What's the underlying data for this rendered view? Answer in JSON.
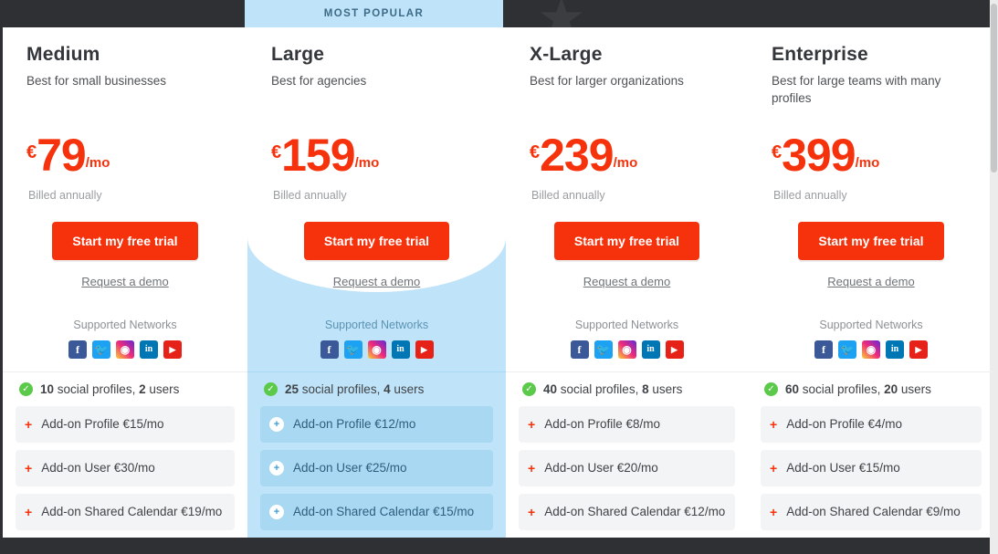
{
  "banner": {
    "most_popular": "MOST POPULAR"
  },
  "labels": {
    "billed": "Billed annually",
    "cta": "Start my free trial",
    "demo": "Request a demo",
    "networks": "Supported Networks",
    "currency": "€",
    "per": "/mo"
  },
  "networks": [
    {
      "name": "facebook-icon",
      "glyph": "f"
    },
    {
      "name": "twitter-icon",
      "glyph": "🐦"
    },
    {
      "name": "instagram-icon",
      "glyph": "◉"
    },
    {
      "name": "linkedin-icon",
      "glyph": "in"
    },
    {
      "name": "youtube-icon",
      "glyph": "▶"
    }
  ],
  "colors": {
    "accent": "#f5320c",
    "featured_bg": "#bfe3f8",
    "banner_bg": "#bfe3f8",
    "page_bg": "#2f3033",
    "check_green": "#5bc94a"
  },
  "plans": [
    {
      "name": "Medium",
      "desc": "Best for small businesses",
      "price": "79",
      "featured": false,
      "profiles_count": "10",
      "profiles_label": " social profiles, ",
      "users_count": "2",
      "users_label": " users",
      "addons": [
        "Add-on Profile €15/mo",
        "Add-on User €30/mo",
        "Add-on Shared Calendar €19/mo"
      ]
    },
    {
      "name": "Large",
      "desc": "Best for agencies",
      "price": "159",
      "featured": true,
      "profiles_count": "25",
      "profiles_label": " social profiles, ",
      "users_count": "4",
      "users_label": " users",
      "addons": [
        "Add-on Profile €12/mo",
        "Add-on User €25/mo",
        "Add-on Shared Calendar €15/mo"
      ]
    },
    {
      "name": "X-Large",
      "desc": "Best for larger organizations",
      "price": "239",
      "featured": false,
      "profiles_count": "40",
      "profiles_label": " social profiles, ",
      "users_count": "8",
      "users_label": " users",
      "addons": [
        "Add-on Profile €8/mo",
        "Add-on User €20/mo",
        "Add-on Shared Calendar €12/mo"
      ]
    },
    {
      "name": "Enterprise",
      "desc": "Best for large teams with many profiles",
      "price": "399",
      "featured": false,
      "profiles_count": "60",
      "profiles_label": " social profiles, ",
      "users_count": "20",
      "users_label": " users",
      "addons": [
        "Add-on Profile €4/mo",
        "Add-on User €15/mo",
        "Add-on Shared Calendar €9/mo"
      ]
    }
  ]
}
